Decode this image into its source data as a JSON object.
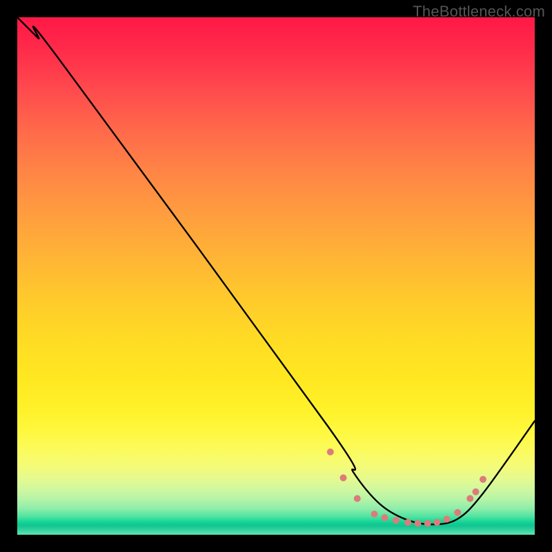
{
  "watermark": "TheBottleneck.com",
  "chart_data": {
    "type": "line",
    "title": "",
    "xlabel": "",
    "ylabel": "",
    "xlim": [
      0,
      100
    ],
    "ylim": [
      0,
      100
    ],
    "background": "vertical-heat-gradient red→yellow→green",
    "series": [
      {
        "name": "bottleneck-curve",
        "x": [
          0,
          4,
          8,
          60,
          65,
          70,
          75,
          80,
          85,
          90,
          100
        ],
        "y": [
          100,
          96,
          92,
          21,
          12,
          6,
          3,
          2,
          3,
          8,
          22
        ]
      }
    ],
    "markers": {
      "name": "datapoints",
      "x": [
        60.5,
        63.0,
        65.7,
        69.0,
        71.0,
        73.2,
        75.5,
        77.4,
        79.3,
        81.1,
        83.0,
        85.1,
        87.5,
        88.6,
        90.0
      ],
      "y": [
        16.0,
        11.0,
        7.0,
        4.0,
        3.3,
        2.8,
        2.4,
        2.2,
        2.2,
        2.4,
        3.0,
        4.3,
        7.0,
        8.3,
        10.7
      ],
      "r": 5
    }
  }
}
